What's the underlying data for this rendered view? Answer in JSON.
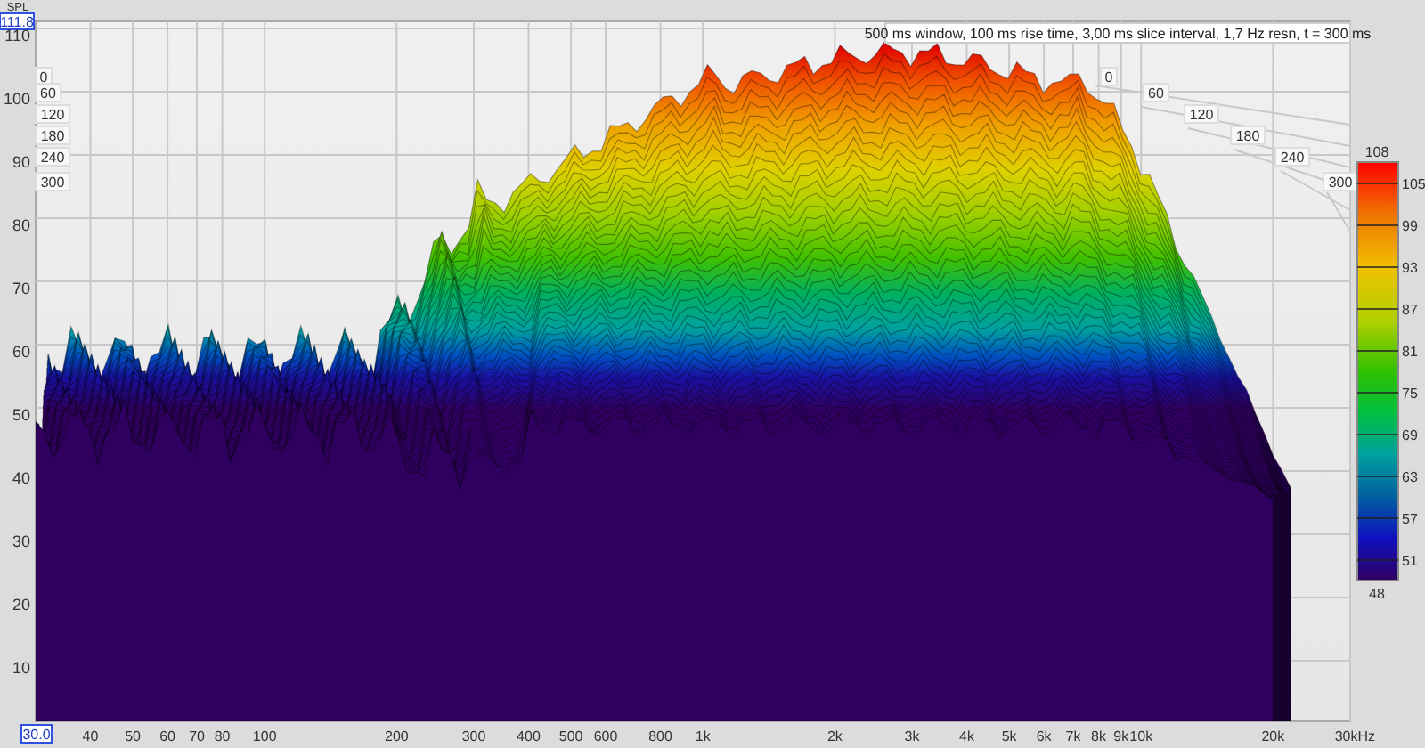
{
  "y_axis": {
    "unit": "SPL",
    "cursor_value": "111.8",
    "ticks": [
      "110",
      "100",
      "90",
      "80",
      "70",
      "60",
      "50",
      "40",
      "30",
      "20",
      "10"
    ]
  },
  "x_axis": {
    "cursor_value": "30.0",
    "ticks": [
      "40",
      "50",
      "60",
      "70",
      "80",
      "100",
      "200",
      "300",
      "400",
      "500",
      "600",
      "800",
      "1k",
      "2k",
      "3k",
      "4k",
      "5k",
      "6k",
      "7k",
      "8k",
      "9k",
      "10k",
      "20k",
      "30kHz"
    ]
  },
  "info": "500 ms window, 100 ms rise time, 3,00 ms slice interval, 1,7 Hz resn, t = 300 ms",
  "time_axis": {
    "left_labels": [
      "0",
      "60",
      "120",
      "180",
      "240",
      "300"
    ],
    "right_labels": [
      "0",
      "60",
      "120",
      "180",
      "240",
      "300"
    ]
  },
  "color_scale": {
    "max": "108",
    "min": "48",
    "ticks": [
      "105",
      "99",
      "93",
      "87",
      "81",
      "75",
      "69",
      "63",
      "57",
      "51"
    ]
  }
}
